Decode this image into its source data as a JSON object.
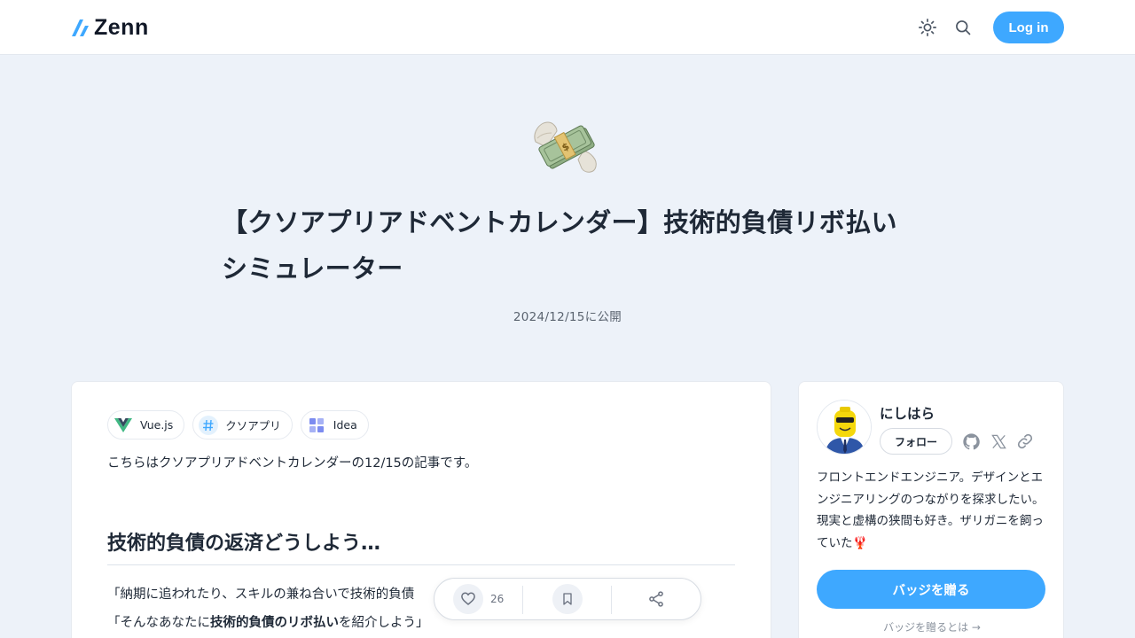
{
  "header": {
    "logo_text": "Zenn",
    "theme_icon": "sun-icon",
    "search_icon": "search-icon",
    "login_label": "Log in",
    "accent_color": "#3ea8ff"
  },
  "article": {
    "emoji": "money-with-wings",
    "title": "【クソアプリアドベントカレンダー】技術的負債リボ払いシミュレーター",
    "published": "2024/12/15に公開",
    "topics": [
      {
        "label": "Vue.js",
        "icon": "vuejs-icon"
      },
      {
        "label": "クソアプリ",
        "icon": "hash-icon"
      },
      {
        "label": "Idea",
        "icon": "idea-icon"
      }
    ],
    "intro": "こちらはクソアプリアドベントカレンダーの12/15の記事です。",
    "heading": "技術的負債の返済どうしよう…",
    "p1": "「納期に追われたり、スキルの兼ね合いで技術的負債",
    "p2_before": "「そんなあなたに",
    "p2_bold": "技術的負債のリボ払い",
    "p2_after": "を紹介しよう」"
  },
  "actions": {
    "like_count": "26",
    "like_icon": "heart-icon",
    "bookmark_icon": "bookmark-icon",
    "share_icon": "share-icon"
  },
  "author": {
    "name": "にしはら",
    "follow_label": "フォロー",
    "social": [
      "github-icon",
      "x-icon",
      "link-icon"
    ],
    "bio": "フロントエンドエンジニア。デザインとエンジニアリングのつながりを探求したい。現実と虚構の狭間も好き。ザリガニを飼っていた🦞",
    "badge_label": "バッジを贈る",
    "badge_about": "バッジを贈るとは →"
  }
}
